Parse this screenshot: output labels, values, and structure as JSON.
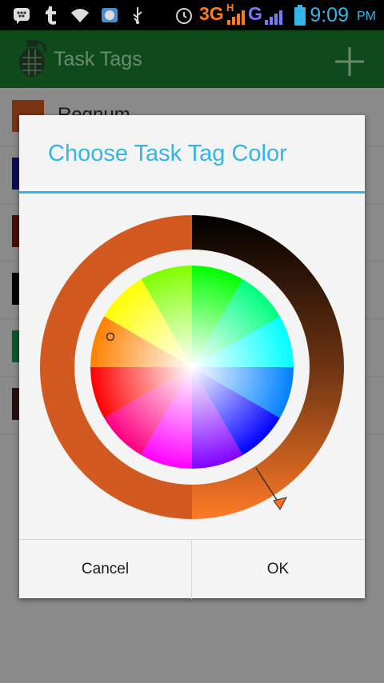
{
  "status_bar": {
    "network": "3G",
    "h_label": "H",
    "g_label": "G",
    "time": "9:09",
    "ampm": "PM"
  },
  "action_bar": {
    "title": "Task Tags"
  },
  "list": {
    "items": [
      {
        "label": "Regnum",
        "color": "#d2591f"
      },
      {
        "label": "",
        "color": "#0b0c7f"
      },
      {
        "label": "",
        "color": "#7a1206"
      },
      {
        "label": "",
        "color": "#0a0a0a"
      },
      {
        "label": "",
        "color": "#0a7a3a"
      },
      {
        "label": "",
        "color": "#3e1414"
      }
    ]
  },
  "dialog": {
    "title": "Choose Task Tag Color",
    "cancel_label": "Cancel",
    "ok_label": "OK",
    "selected_color": "#d2591f",
    "accent": "#33b5e5"
  }
}
